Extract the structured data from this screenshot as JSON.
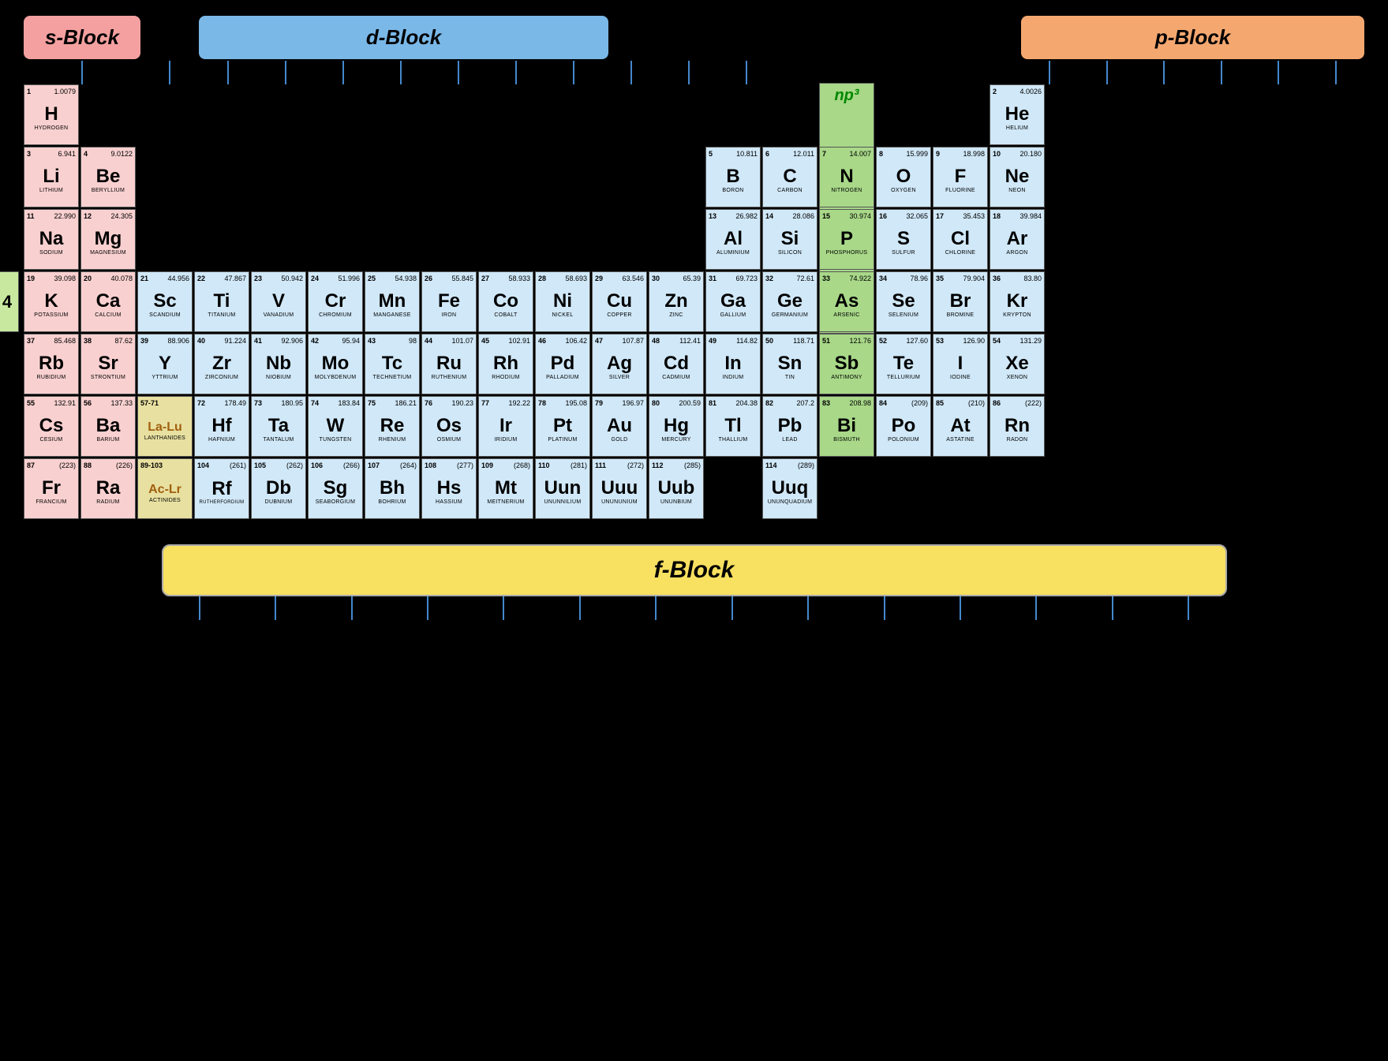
{
  "blocks": {
    "s": "s-Block",
    "d": "d-Block",
    "p": "p-Block",
    "f": "f-Block",
    "np3": "np³"
  },
  "elements": [
    {
      "num": "1",
      "mass": "1.0079",
      "sym": "H",
      "name": "HYDROGEN",
      "row": 1,
      "col": 1,
      "type": "s-block"
    },
    {
      "num": "2",
      "mass": "4.0026",
      "sym": "He",
      "name": "HELIUM",
      "row": 1,
      "col": 18,
      "type": "p-block"
    },
    {
      "num": "3",
      "mass": "6.941",
      "sym": "Li",
      "name": "LITHIUM",
      "row": 2,
      "col": 1,
      "type": "s-block"
    },
    {
      "num": "4",
      "mass": "9.0122",
      "sym": "Be",
      "name": "BERYLLIUM",
      "row": 2,
      "col": 2,
      "type": "s-block"
    },
    {
      "num": "5",
      "mass": "10.811",
      "sym": "B",
      "name": "BORON",
      "row": 2,
      "col": 13,
      "type": "p-block"
    },
    {
      "num": "6",
      "mass": "12.011",
      "sym": "C",
      "name": "CARBON",
      "row": 2,
      "col": 14,
      "type": "p-block"
    },
    {
      "num": "7",
      "mass": "14.007",
      "sym": "N",
      "name": "NITROGEN",
      "row": 2,
      "col": 15,
      "type": "np3"
    },
    {
      "num": "8",
      "mass": "15.999",
      "sym": "O",
      "name": "OXYGEN",
      "row": 2,
      "col": 16,
      "type": "p-block"
    },
    {
      "num": "9",
      "mass": "18.998",
      "sym": "F",
      "name": "FLUORINE",
      "row": 2,
      "col": 17,
      "type": "p-block"
    },
    {
      "num": "10",
      "mass": "20.180",
      "sym": "Ne",
      "name": "NEON",
      "row": 2,
      "col": 18,
      "type": "p-block"
    },
    {
      "num": "11",
      "mass": "22.990",
      "sym": "Na",
      "name": "SODIUM",
      "row": 3,
      "col": 1,
      "type": "s-block"
    },
    {
      "num": "12",
      "mass": "24.305",
      "sym": "Mg",
      "name": "MAGNESIUM",
      "row": 3,
      "col": 2,
      "type": "s-block"
    },
    {
      "num": "13",
      "mass": "26.982",
      "sym": "Al",
      "name": "ALUMINIUM",
      "row": 3,
      "col": 13,
      "type": "p-block"
    },
    {
      "num": "14",
      "mass": "28.086",
      "sym": "Si",
      "name": "SILICON",
      "row": 3,
      "col": 14,
      "type": "p-block"
    },
    {
      "num": "15",
      "mass": "30.974",
      "sym": "P",
      "name": "PHOSPHORUS",
      "row": 3,
      "col": 15,
      "type": "np3"
    },
    {
      "num": "16",
      "mass": "32.065",
      "sym": "S",
      "name": "SULFUR",
      "row": 3,
      "col": 16,
      "type": "p-block"
    },
    {
      "num": "17",
      "mass": "35.453",
      "sym": "Cl",
      "name": "CHLORINE",
      "row": 3,
      "col": 17,
      "type": "p-block"
    },
    {
      "num": "18",
      "mass": "39.984",
      "sym": "Ar",
      "name": "ARGON",
      "row": 3,
      "col": 18,
      "type": "p-block"
    },
    {
      "num": "19",
      "mass": "39.098",
      "sym": "K",
      "name": "POTASSIUM",
      "row": 4,
      "col": 1,
      "type": "s-block"
    },
    {
      "num": "20",
      "mass": "40.078",
      "sym": "Ca",
      "name": "CALCIUM",
      "row": 4,
      "col": 2,
      "type": "s-block"
    },
    {
      "num": "21",
      "mass": "44.956",
      "sym": "Sc",
      "name": "SCANDIUM",
      "row": 4,
      "col": 3,
      "type": "d-block"
    },
    {
      "num": "22",
      "mass": "47.867",
      "sym": "Ti",
      "name": "TITANIUM",
      "row": 4,
      "col": 4,
      "type": "d-block"
    },
    {
      "num": "23",
      "mass": "50.942",
      "sym": "V",
      "name": "VANADIUM",
      "row": 4,
      "col": 5,
      "type": "d-block"
    },
    {
      "num": "24",
      "mass": "51.996",
      "sym": "Cr",
      "name": "CHROMIUM",
      "row": 4,
      "col": 6,
      "type": "d-block"
    },
    {
      "num": "25",
      "mass": "54.938",
      "sym": "Mn",
      "name": "MANGANESE",
      "row": 4,
      "col": 7,
      "type": "d-block"
    },
    {
      "num": "26",
      "mass": "55.845",
      "sym": "Fe",
      "name": "IRON",
      "row": 4,
      "col": 8,
      "type": "d-block"
    },
    {
      "num": "27",
      "mass": "58.933",
      "sym": "Co",
      "name": "COBALT",
      "row": 4,
      "col": 9,
      "type": "d-block"
    },
    {
      "num": "28",
      "mass": "58.693",
      "sym": "Ni",
      "name": "NICKEL",
      "row": 4,
      "col": 10,
      "type": "d-block"
    },
    {
      "num": "29",
      "mass": "63.546",
      "sym": "Cu",
      "name": "COPPER",
      "row": 4,
      "col": 11,
      "type": "d-block"
    },
    {
      "num": "30",
      "mass": "65.39",
      "sym": "Zn",
      "name": "ZINC",
      "row": 4,
      "col": 12,
      "type": "d-block"
    },
    {
      "num": "31",
      "mass": "69.723",
      "sym": "Ga",
      "name": "GALLIUM",
      "row": 4,
      "col": 13,
      "type": "p-block"
    },
    {
      "num": "32",
      "mass": "72.61",
      "sym": "Ge",
      "name": "GERMANIUM",
      "row": 4,
      "col": 14,
      "type": "p-block"
    },
    {
      "num": "33",
      "mass": "74.922",
      "sym": "As",
      "name": "ARSENIC",
      "row": 4,
      "col": 15,
      "type": "np3"
    },
    {
      "num": "34",
      "mass": "78.96",
      "sym": "Se",
      "name": "SELENIUM",
      "row": 4,
      "col": 16,
      "type": "p-block"
    },
    {
      "num": "35",
      "mass": "79.904",
      "sym": "Br",
      "name": "BROMINE",
      "row": 4,
      "col": 17,
      "type": "p-block"
    },
    {
      "num": "36",
      "mass": "83.80",
      "sym": "Kr",
      "name": "KRYPTON",
      "row": 4,
      "col": 18,
      "type": "p-block"
    },
    {
      "num": "37",
      "mass": "85.468",
      "sym": "Rb",
      "name": "RUBIDIUM",
      "row": 5,
      "col": 1,
      "type": "s-block"
    },
    {
      "num": "38",
      "mass": "87.62",
      "sym": "Sr",
      "name": "STRONTIUM",
      "row": 5,
      "col": 2,
      "type": "s-block"
    },
    {
      "num": "39",
      "mass": "88.906",
      "sym": "Y",
      "name": "YTTRIUM",
      "row": 5,
      "col": 3,
      "type": "d-block"
    },
    {
      "num": "40",
      "mass": "91.224",
      "sym": "Zr",
      "name": "ZIRCONIUM",
      "row": 5,
      "col": 4,
      "type": "d-block"
    },
    {
      "num": "41",
      "mass": "92.906",
      "sym": "Nb",
      "name": "NIOBIUM",
      "row": 5,
      "col": 5,
      "type": "d-block"
    },
    {
      "num": "42",
      "mass": "95.94",
      "sym": "Mo",
      "name": "MOLYBDENUM",
      "row": 5,
      "col": 6,
      "type": "d-block"
    },
    {
      "num": "43",
      "mass": "98",
      "sym": "Tc",
      "name": "TECHNETIUM",
      "row": 5,
      "col": 7,
      "type": "d-block"
    },
    {
      "num": "44",
      "mass": "101.07",
      "sym": "Ru",
      "name": "RUTHENIUM",
      "row": 5,
      "col": 8,
      "type": "d-block"
    },
    {
      "num": "45",
      "mass": "102.91",
      "sym": "Rh",
      "name": "RHODIUM",
      "row": 5,
      "col": 9,
      "type": "d-block"
    },
    {
      "num": "46",
      "mass": "106.42",
      "sym": "Pd",
      "name": "PALLADIUM",
      "row": 5,
      "col": 10,
      "type": "d-block"
    },
    {
      "num": "47",
      "mass": "107.87",
      "sym": "Ag",
      "name": "SILVER",
      "row": 5,
      "col": 11,
      "type": "d-block"
    },
    {
      "num": "48",
      "mass": "112.41",
      "sym": "Cd",
      "name": "CADMIUM",
      "row": 5,
      "col": 12,
      "type": "d-block"
    },
    {
      "num": "49",
      "mass": "114.82",
      "sym": "In",
      "name": "INDIUM",
      "row": 5,
      "col": 13,
      "type": "p-block"
    },
    {
      "num": "50",
      "mass": "118.71",
      "sym": "Sn",
      "name": "TIN",
      "row": 5,
      "col": 14,
      "type": "p-block"
    },
    {
      "num": "51",
      "mass": "121.76",
      "sym": "Sb",
      "name": "ANTIMONY",
      "row": 5,
      "col": 15,
      "type": "np3"
    },
    {
      "num": "52",
      "mass": "127.60",
      "sym": "Te",
      "name": "TELLURIUM",
      "row": 5,
      "col": 16,
      "type": "p-block"
    },
    {
      "num": "53",
      "mass": "126.90",
      "sym": "I",
      "name": "IODINE",
      "row": 5,
      "col": 17,
      "type": "p-block"
    },
    {
      "num": "54",
      "mass": "131.29",
      "sym": "Xe",
      "name": "XENON",
      "row": 5,
      "col": 18,
      "type": "p-block"
    },
    {
      "num": "55",
      "mass": "132.91",
      "sym": "Cs",
      "name": "CESIUM",
      "row": 6,
      "col": 1,
      "type": "s-block"
    },
    {
      "num": "56",
      "mass": "137.33",
      "sym": "Ba",
      "name": "BARIUM",
      "row": 6,
      "col": 2,
      "type": "s-block"
    },
    {
      "num": "57-71",
      "mass": "",
      "sym": "La-Lu",
      "name": "LANTHANIDES",
      "row": 6,
      "col": 3,
      "type": "la-lu"
    },
    {
      "num": "72",
      "mass": "178.49",
      "sym": "Hf",
      "name": "HAFNIUM",
      "row": 6,
      "col": 4,
      "type": "d-block"
    },
    {
      "num": "73",
      "mass": "180.95",
      "sym": "Ta",
      "name": "TANTALUM",
      "row": 6,
      "col": 5,
      "type": "d-block"
    },
    {
      "num": "74",
      "mass": "183.84",
      "sym": "W",
      "name": "TUNGSTEN",
      "row": 6,
      "col": 6,
      "type": "d-block"
    },
    {
      "num": "75",
      "mass": "186.21",
      "sym": "Re",
      "name": "RHENIUM",
      "row": 6,
      "col": 7,
      "type": "d-block"
    },
    {
      "num": "76",
      "mass": "190.23",
      "sym": "Os",
      "name": "OSMIUM",
      "row": 6,
      "col": 8,
      "type": "d-block"
    },
    {
      "num": "77",
      "mass": "192.22",
      "sym": "Ir",
      "name": "IRIDIUM",
      "row": 6,
      "col": 9,
      "type": "d-block"
    },
    {
      "num": "78",
      "mass": "195.08",
      "sym": "Pt",
      "name": "PLATINUM",
      "row": 6,
      "col": 10,
      "type": "d-block"
    },
    {
      "num": "79",
      "mass": "196.97",
      "sym": "Au",
      "name": "GOLD",
      "row": 6,
      "col": 11,
      "type": "d-block"
    },
    {
      "num": "80",
      "mass": "200.59",
      "sym": "Hg",
      "name": "MERCURY",
      "row": 6,
      "col": 12,
      "type": "d-block"
    },
    {
      "num": "81",
      "mass": "204.38",
      "sym": "Tl",
      "name": "THALLIUM",
      "row": 6,
      "col": 13,
      "type": "p-block"
    },
    {
      "num": "82",
      "mass": "207.2",
      "sym": "Pb",
      "name": "LEAD",
      "row": 6,
      "col": 14,
      "type": "p-block"
    },
    {
      "num": "83",
      "mass": "208.98",
      "sym": "Bi",
      "name": "BISMUTH",
      "row": 6,
      "col": 15,
      "type": "np3"
    },
    {
      "num": "84",
      "mass": "(209)",
      "sym": "Po",
      "name": "POLONIUM",
      "row": 6,
      "col": 16,
      "type": "p-block"
    },
    {
      "num": "85",
      "mass": "(210)",
      "sym": "At",
      "name": "ASTATINE",
      "row": 6,
      "col": 17,
      "type": "p-block"
    },
    {
      "num": "86",
      "mass": "(222)",
      "sym": "Rn",
      "name": "RADON",
      "row": 6,
      "col": 18,
      "type": "p-block"
    },
    {
      "num": "87",
      "mass": "(223)",
      "sym": "Fr",
      "name": "FRANCIUM",
      "row": 7,
      "col": 1,
      "type": "s-block"
    },
    {
      "num": "88",
      "mass": "(226)",
      "sym": "Ra",
      "name": "RADIUM",
      "row": 7,
      "col": 2,
      "type": "s-block"
    },
    {
      "num": "89-103",
      "mass": "",
      "sym": "Ac-Lr",
      "name": "ACTINIDES",
      "row": 7,
      "col": 3,
      "type": "actinide"
    },
    {
      "num": "104",
      "mass": "(261)",
      "sym": "Rf",
      "name": "RUTHERFORDIUM",
      "row": 7,
      "col": 4,
      "type": "d-block"
    },
    {
      "num": "105",
      "mass": "(262)",
      "sym": "Db",
      "name": "DUBNIUM",
      "row": 7,
      "col": 5,
      "type": "d-block"
    },
    {
      "num": "106",
      "mass": "(266)",
      "sym": "Sg",
      "name": "SEABORGIUM",
      "row": 7,
      "col": 6,
      "type": "d-block"
    },
    {
      "num": "107",
      "mass": "(264)",
      "sym": "Bh",
      "name": "BOHRIUM",
      "row": 7,
      "col": 7,
      "type": "d-block"
    },
    {
      "num": "108",
      "mass": "(277)",
      "sym": "Hs",
      "name": "HASSIUM",
      "row": 7,
      "col": 8,
      "type": "d-block"
    },
    {
      "num": "109",
      "mass": "(268)",
      "sym": "Mt",
      "name": "MEITNERIUM",
      "row": 7,
      "col": 9,
      "type": "d-block"
    },
    {
      "num": "110",
      "mass": "(281)",
      "sym": "Uun",
      "name": "UNUNNILIUM",
      "row": 7,
      "col": 10,
      "type": "d-block"
    },
    {
      "num": "111",
      "mass": "(272)",
      "sym": "Uuu",
      "name": "UNUNUNIUM",
      "row": 7,
      "col": 11,
      "type": "d-block"
    },
    {
      "num": "112",
      "mass": "(285)",
      "sym": "Uub",
      "name": "UNUNBIUM",
      "row": 7,
      "col": 12,
      "type": "d-block"
    },
    {
      "num": "114",
      "mass": "(289)",
      "sym": "Uuq",
      "name": "UNUNQUADIUM",
      "row": 7,
      "col": 14,
      "type": "p-block"
    }
  ]
}
